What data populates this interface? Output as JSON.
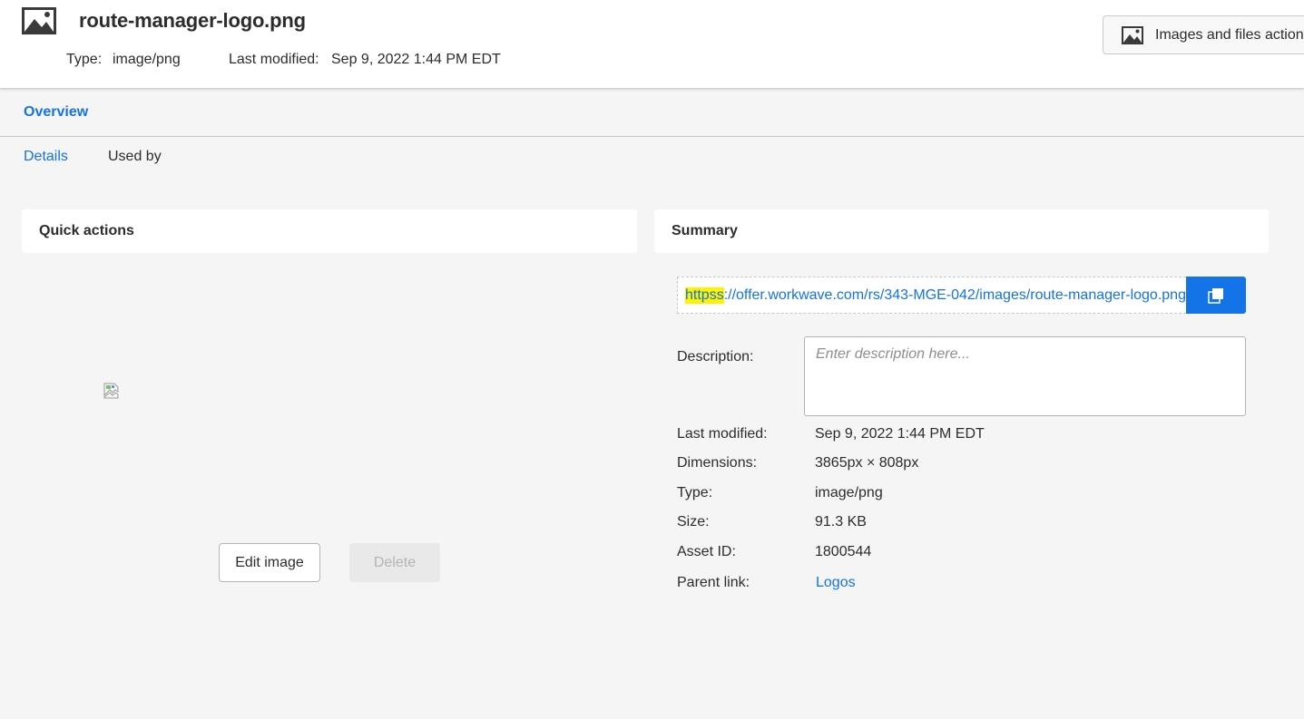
{
  "header": {
    "file_name": "route-manager-logo.png",
    "type_label": "Type:",
    "type_value": "image/png",
    "modified_label": "Last modified:",
    "modified_value": "Sep 9, 2022 1:44 PM EDT",
    "actions_button_label": "Images and files actions",
    "file_icon": "image-icon"
  },
  "tabs": {
    "overview": "Overview",
    "details": "Details",
    "used_by": "Used by"
  },
  "quick_actions": {
    "title": "Quick actions",
    "preview_icon": "broken-image-icon",
    "edit_label": "Edit image",
    "delete_label": "Delete"
  },
  "summary": {
    "title": "Summary",
    "url_highlight": "httpss",
    "url_rest": "://offer.workwave.com/rs/343-MGE-042/images/route-manager-logo.png",
    "copy_icon": "copy-icon",
    "description_label": "Description:",
    "description_placeholder": "Enter description here...",
    "fields": {
      "last_modified_label": "Last modified:",
      "last_modified_value": "Sep 9, 2022 1:44 PM EDT",
      "dimensions_label": "Dimensions:",
      "dimensions_value": "3865px × 808px",
      "type_label": "Type:",
      "type_value": "image/png",
      "size_label": "Size:",
      "size_value": "91.3 KB",
      "asset_id_label": "Asset ID:",
      "asset_id_value": "1800544",
      "parent_link_label": "Parent link:",
      "parent_link_value": "Logos"
    }
  },
  "colors": {
    "accent": "#1473e6",
    "highlight": "#fdf200",
    "background": "#f5f5f5"
  }
}
